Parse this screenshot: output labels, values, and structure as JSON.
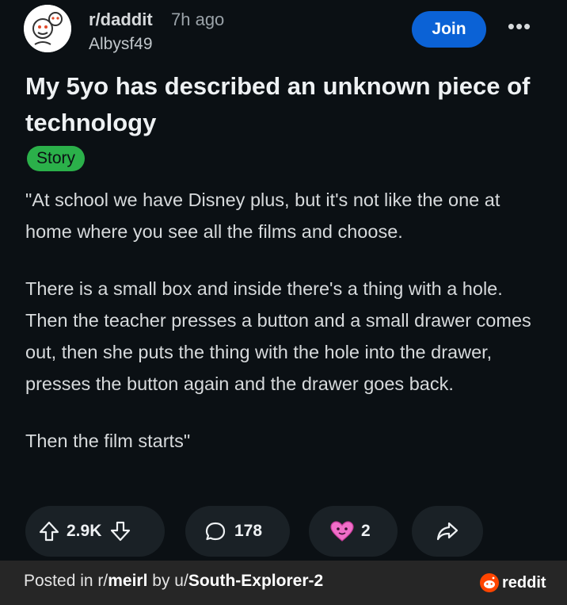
{
  "post": {
    "subreddit": "r/daddit",
    "age": "7h ago",
    "username": "Albysf49",
    "join_label": "Join",
    "more_label": "•••",
    "title": "My 5yo has described an unknown piece of technology",
    "flair": "Story",
    "paragraphs": [
      "\"At school we have Disney plus, but it's not like the one at home where you see all the films and choose.",
      "There is a small box and inside there's a thing with a hole. Then the teacher presses a button and a small drawer comes out, then she puts the thing with the hole into the drawer, presses the button again and the drawer goes back.",
      "Then the film starts\""
    ]
  },
  "actions": {
    "votes": "2.9K",
    "comments": "178",
    "awards": "2"
  },
  "footer": {
    "prefix": "Posted in r/",
    "subreddit": "meirl",
    "by": " by u/",
    "user": "South-Explorer-2",
    "brand": "reddit"
  },
  "colors": {
    "background": "#0b1014",
    "join_button": "#0b62d6",
    "flair": "#2bb04a",
    "footer": "#262626",
    "reddit_orange": "#ff4500"
  }
}
